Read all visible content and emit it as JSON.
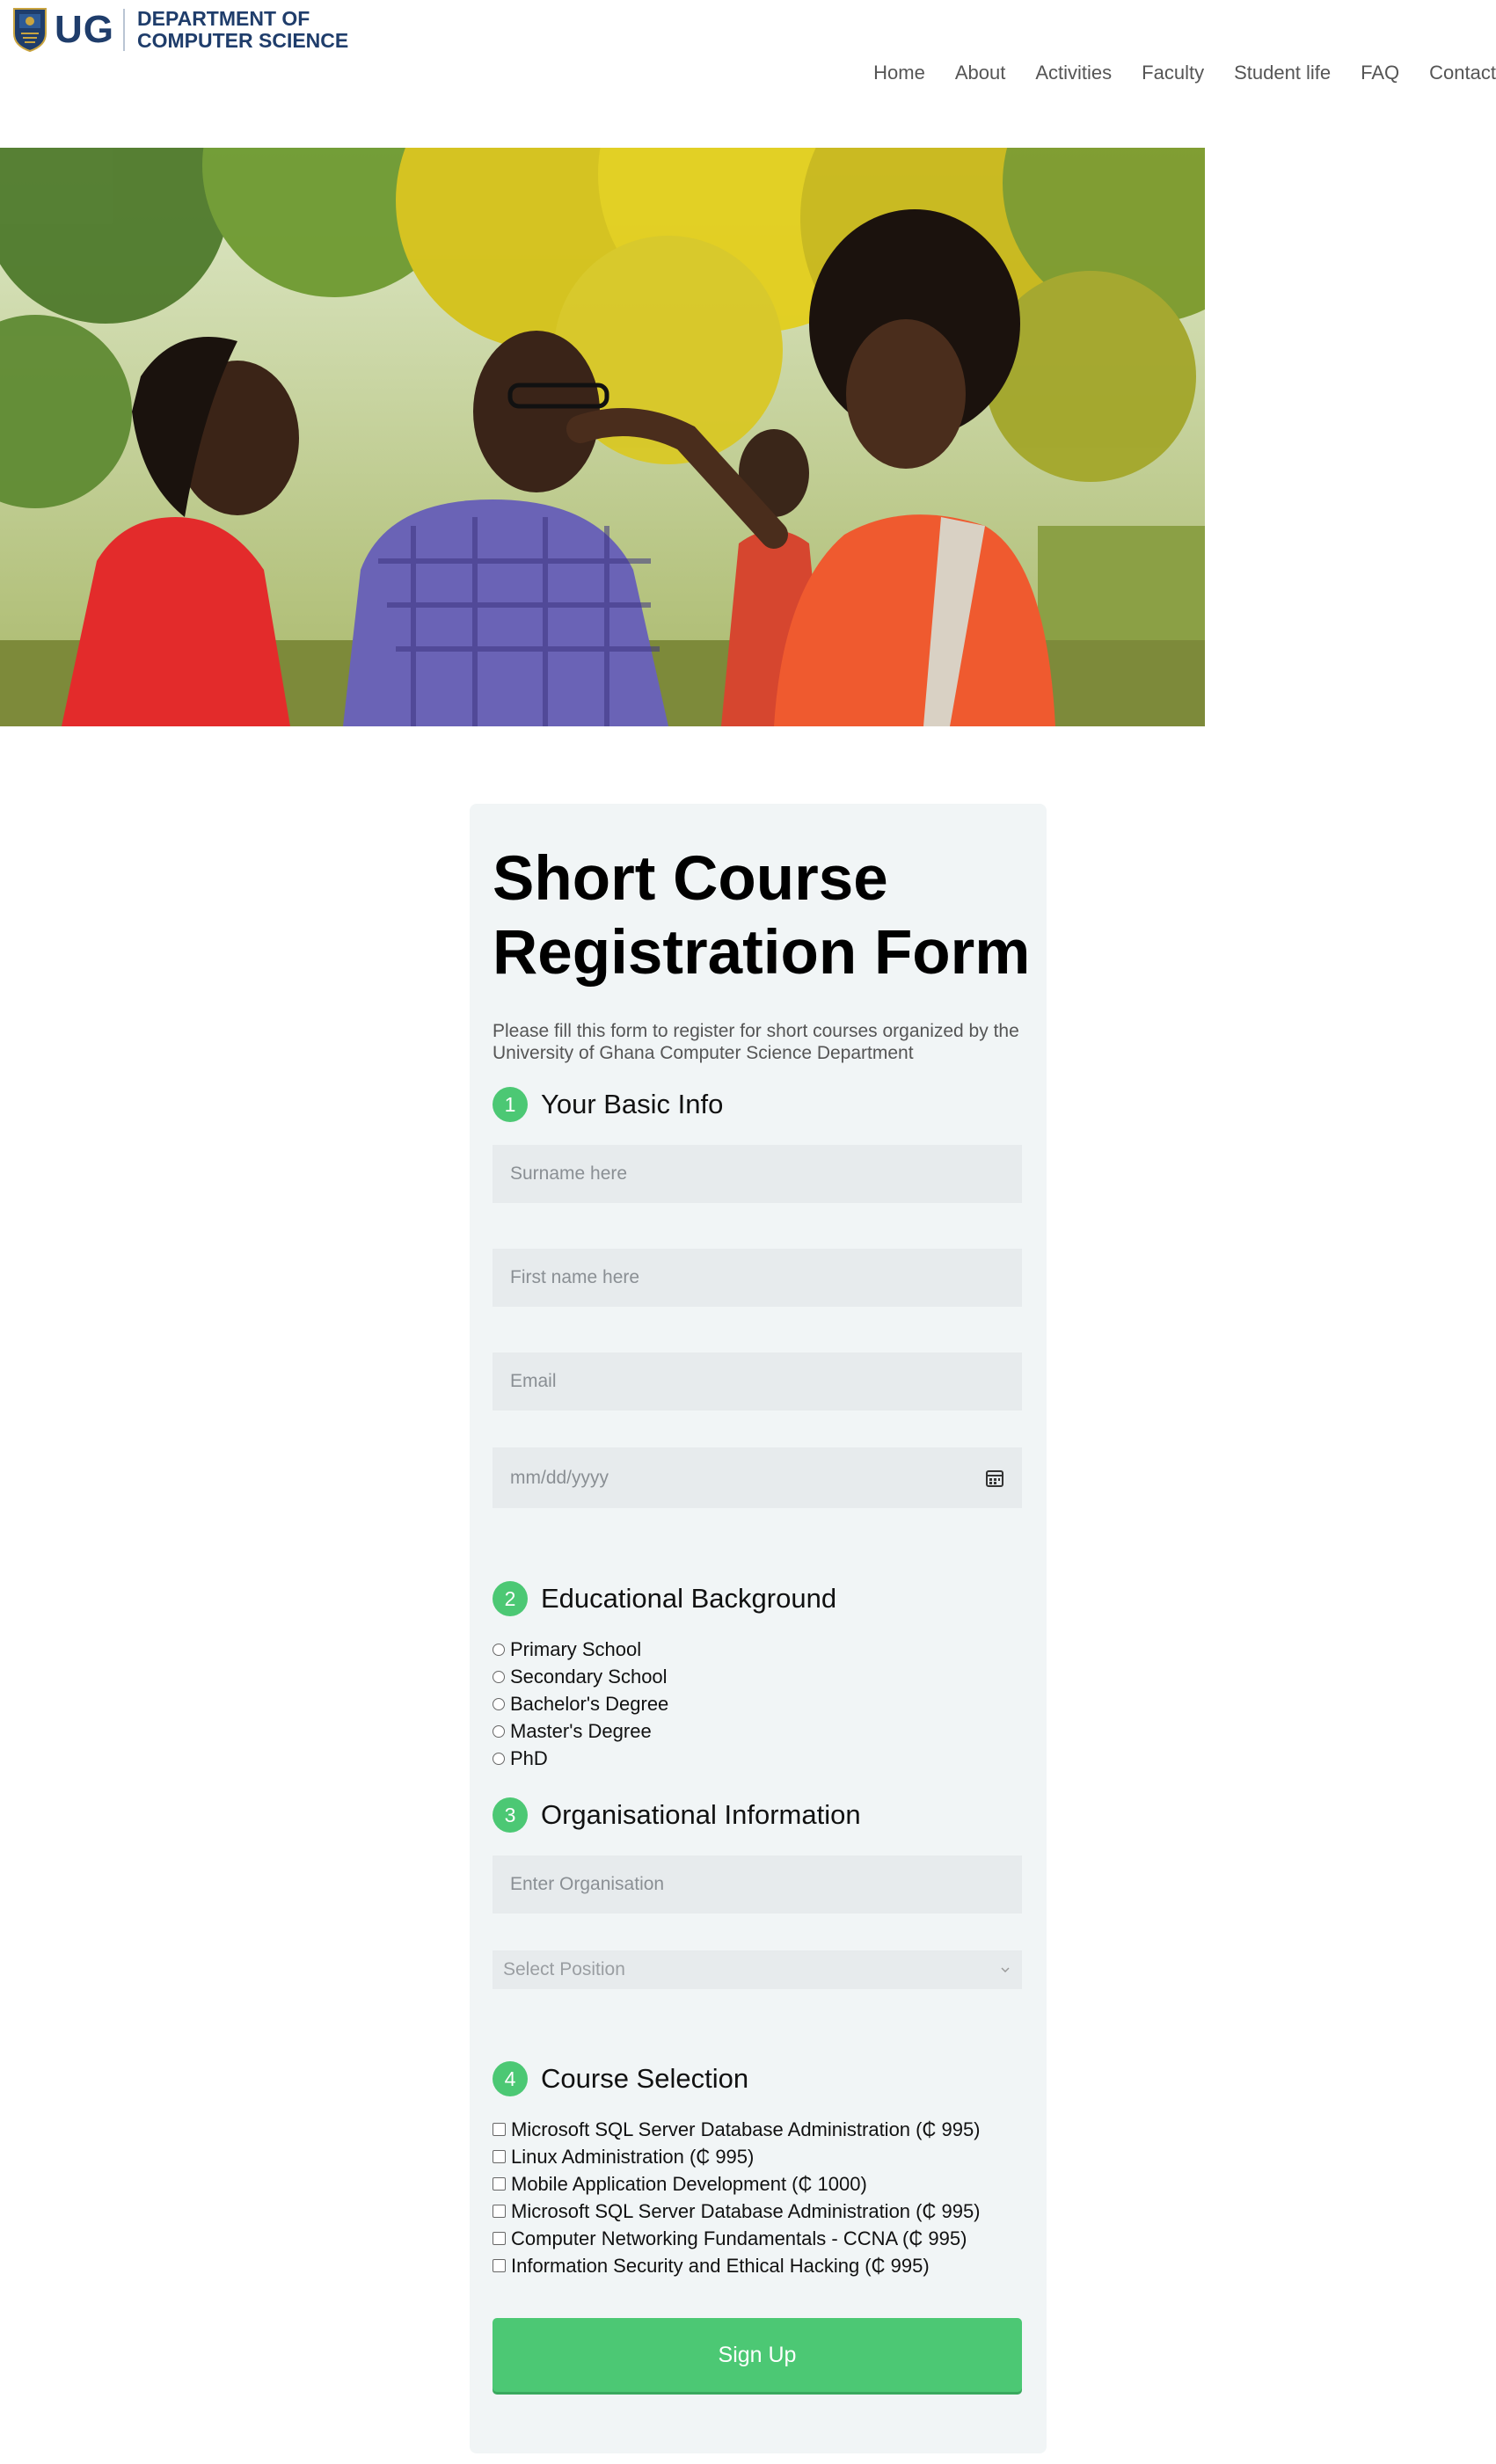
{
  "header": {
    "logo_short": "UG",
    "logo_line1": "DEPARTMENT OF",
    "logo_line2": "COMPUTER SCIENCE",
    "nav": [
      "Home",
      "About",
      "Activities",
      "Faculty",
      "Student life",
      "FAQ",
      "Contact"
    ]
  },
  "hero": {
    "icon": "students-photo"
  },
  "form": {
    "title": "Short Course Registration Form",
    "intro": "Please fill this form to register for short courses organized by the University of Ghana Computer Science Department",
    "sections": [
      {
        "number": "1",
        "title": "Your Basic Info"
      },
      {
        "number": "2",
        "title": "Educational Background"
      },
      {
        "number": "3",
        "title": "Organisational Information"
      },
      {
        "number": "4",
        "title": "Course Selection"
      }
    ],
    "basic": {
      "surname_placeholder": "Surname here",
      "firstname_placeholder": "First name here",
      "email_placeholder": "Email",
      "date_placeholder": "mm/dd/yyyy"
    },
    "education_options": [
      "Primary School",
      "Secondary School",
      "Bachelor's Degree",
      "Master's Degree",
      "PhD"
    ],
    "organisation": {
      "org_placeholder": "Enter Organisation",
      "position_placeholder": "Select Position"
    },
    "courses": [
      "Microsoft SQL Server Database Administration (₵ 995)",
      "Linux Administration (₵ 995)",
      "Mobile Application Development (₵ 1000)",
      "Microsoft SQL Server Database Administration (₵ 995)",
      "Computer Networking Fundamentals - CCNA (₵ 995)",
      "Information Security and Ethical Hacking (₵ 995)"
    ],
    "submit_label": "Sign Up"
  },
  "colors": {
    "accent": "#4cc874",
    "brand": "#1f3d6b",
    "card": "#f1f5f6",
    "field": "#e7ebed"
  }
}
